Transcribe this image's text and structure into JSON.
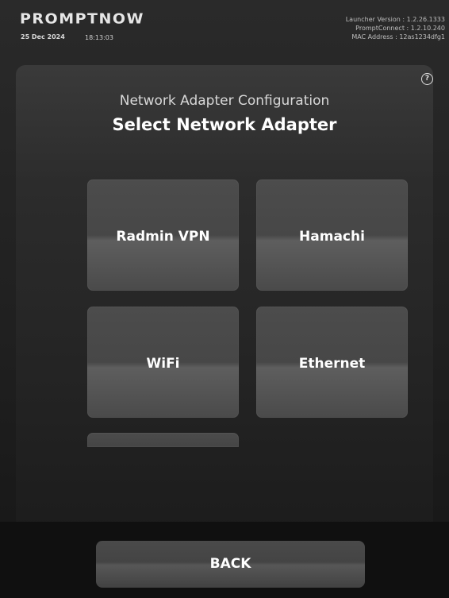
{
  "header": {
    "logo": "PROMPTNOW",
    "date": "25 Dec 2024",
    "time": "18:13:03",
    "launcher_version": "Launcher Version : 1.2.26.1333",
    "prompt_connect": "PromptConnect : 1.2.10.240",
    "mac_address": "MAC Address : 12as1234dfg1"
  },
  "panel": {
    "help_icon": "?",
    "subtitle": "Network Adapter Configuration",
    "title": "Select Network Adapter"
  },
  "adapters": [
    {
      "label": "Radmin VPN"
    },
    {
      "label": "Hamachi"
    },
    {
      "label": "WiFi"
    },
    {
      "label": "Ethernet"
    }
  ],
  "footer": {
    "back_label": "BACK"
  },
  "colors": {
    "background": "#1f1f1f",
    "panel": "#2c2c2c",
    "tile": "#4c4c4c",
    "text": "#ffffff"
  }
}
